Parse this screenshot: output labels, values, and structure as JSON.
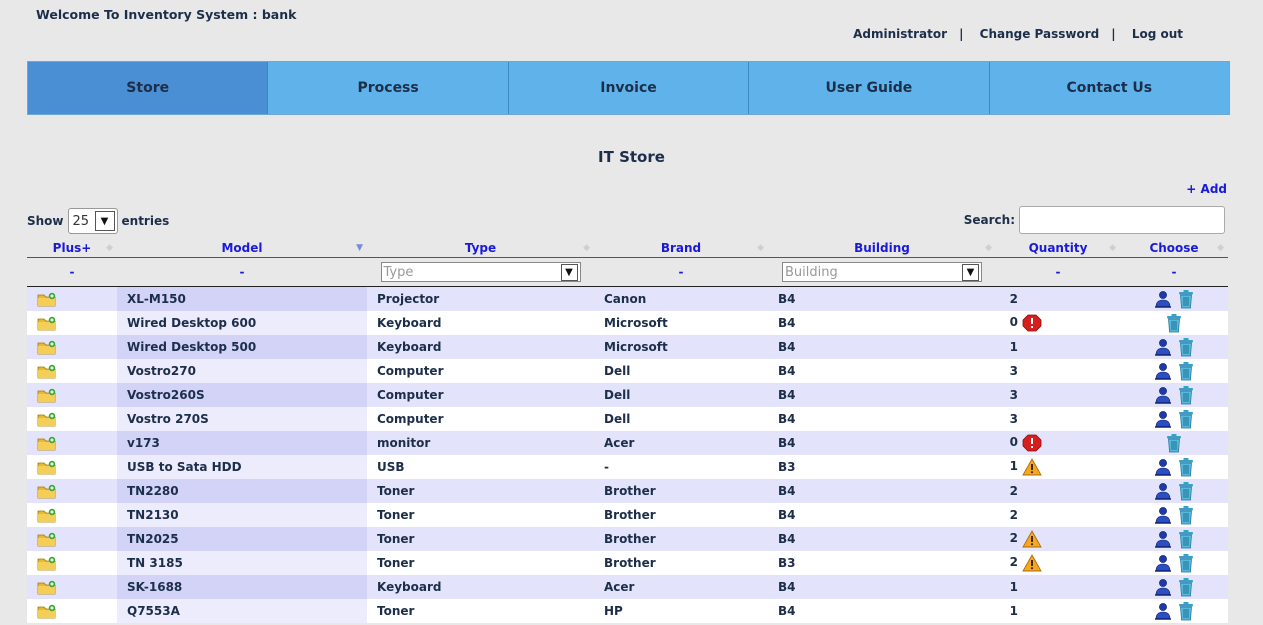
{
  "header": {
    "welcome": "Welcome To Inventory System : bank",
    "links": [
      "Administrator",
      "Change Password",
      "Log out"
    ]
  },
  "nav": {
    "tabs": [
      "Store",
      "Process",
      "Invoice",
      "User Guide",
      "Contact Us"
    ],
    "active": "Store"
  },
  "page": {
    "title": "IT Store",
    "add_label": "+ Add",
    "show_label": "Show",
    "entries_value": "25",
    "entries_label": "entries",
    "search_label": "Search:"
  },
  "table": {
    "columns": [
      "Plus+",
      "Model",
      "Type",
      "Brand",
      "Building",
      "Quantity",
      "Choose"
    ],
    "filter_dash": "-",
    "type_placeholder": "Type",
    "building_placeholder": "Building",
    "rows": [
      {
        "model": "XL-M150",
        "type": "Projector",
        "brand": "Canon",
        "building": "B4",
        "qty": "2",
        "status": "none",
        "user": true
      },
      {
        "model": "Wired Desktop 600",
        "type": "Keyboard",
        "brand": "Microsoft",
        "building": "B4",
        "qty": "0",
        "status": "error",
        "user": false
      },
      {
        "model": "Wired Desktop 500",
        "type": "Keyboard",
        "brand": "Microsoft",
        "building": "B4",
        "qty": "1",
        "status": "none",
        "user": true
      },
      {
        "model": "Vostro270",
        "type": "Computer",
        "brand": "Dell",
        "building": "B4",
        "qty": "3",
        "status": "none",
        "user": true
      },
      {
        "model": "Vostro260S",
        "type": "Computer",
        "brand": "Dell",
        "building": "B4",
        "qty": "3",
        "status": "none",
        "user": true
      },
      {
        "model": "Vostro 270S",
        "type": "Computer",
        "brand": "Dell",
        "building": "B4",
        "qty": "3",
        "status": "none",
        "user": true
      },
      {
        "model": "v173",
        "type": "monitor",
        "brand": "Acer",
        "building": "B4",
        "qty": "0",
        "status": "error",
        "user": false
      },
      {
        "model": "USB to Sata HDD",
        "type": "USB",
        "brand": "-",
        "building": "B3",
        "qty": "1",
        "status": "warning",
        "user": true
      },
      {
        "model": "TN2280",
        "type": "Toner",
        "brand": "Brother",
        "building": "B4",
        "qty": "2",
        "status": "none",
        "user": true
      },
      {
        "model": "TN2130",
        "type": "Toner",
        "brand": "Brother",
        "building": "B4",
        "qty": "2",
        "status": "none",
        "user": true
      },
      {
        "model": "TN2025",
        "type": "Toner",
        "brand": "Brother",
        "building": "B4",
        "qty": "2",
        "status": "warning",
        "user": true
      },
      {
        "model": "TN 3185",
        "type": "Toner",
        "brand": "Brother",
        "building": "B3",
        "qty": "2",
        "status": "warning",
        "user": true
      },
      {
        "model": "SK-1688",
        "type": "Keyboard",
        "brand": "Acer",
        "building": "B4",
        "qty": "1",
        "status": "none",
        "user": true
      },
      {
        "model": "Q7553A",
        "type": "Toner",
        "brand": "HP",
        "building": "B4",
        "qty": "1",
        "status": "none",
        "user": true
      }
    ]
  },
  "icons": {
    "plus_row": "folder-add-icon",
    "assign": "user-icon",
    "delete": "trash-icon",
    "error": "error-stop-icon",
    "warning": "warning-icon"
  },
  "colors": {
    "nav_bg": "#5fb3ea",
    "nav_active": "#4a8ed4",
    "link_blue": "#1a1adc",
    "row_odd": "#e3e4fb",
    "row_even": "#ffffff"
  }
}
